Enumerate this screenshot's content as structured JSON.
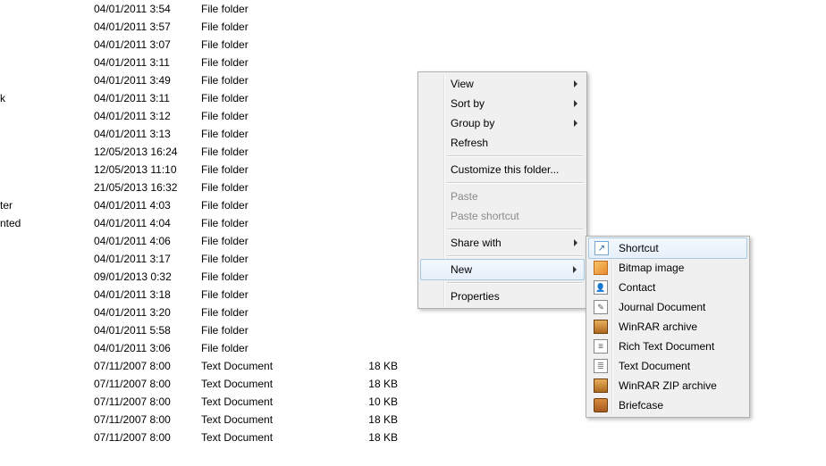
{
  "list": {
    "rows": [
      {
        "name": "",
        "date": "04/01/2011 3:54",
        "type": "File folder",
        "size": ""
      },
      {
        "name": "",
        "date": "04/01/2011 3:57",
        "type": "File folder",
        "size": ""
      },
      {
        "name": "",
        "date": "04/01/2011 3:07",
        "type": "File folder",
        "size": ""
      },
      {
        "name": "",
        "date": "04/01/2011 3:11",
        "type": "File folder",
        "size": ""
      },
      {
        "name": "",
        "date": "04/01/2011 3:49",
        "type": "File folder",
        "size": ""
      },
      {
        "name": "k",
        "date": "04/01/2011 3:11",
        "type": "File folder",
        "size": ""
      },
      {
        "name": "",
        "date": "04/01/2011 3:12",
        "type": "File folder",
        "size": ""
      },
      {
        "name": "",
        "date": "04/01/2011 3:13",
        "type": "File folder",
        "size": ""
      },
      {
        "name": "",
        "date": "12/05/2013 16:24",
        "type": "File folder",
        "size": ""
      },
      {
        "name": "",
        "date": "12/05/2013 11:10",
        "type": "File folder",
        "size": ""
      },
      {
        "name": "",
        "date": "21/05/2013 16:32",
        "type": "File folder",
        "size": ""
      },
      {
        "name": "ter",
        "date": "04/01/2011 4:03",
        "type": "File folder",
        "size": ""
      },
      {
        "name": "nted",
        "date": "04/01/2011 4:04",
        "type": "File folder",
        "size": ""
      },
      {
        "name": "",
        "date": "04/01/2011 4:06",
        "type": "File folder",
        "size": ""
      },
      {
        "name": "",
        "date": "04/01/2011 3:17",
        "type": "File folder",
        "size": ""
      },
      {
        "name": "",
        "date": "09/01/2013 0:32",
        "type": "File folder",
        "size": ""
      },
      {
        "name": "",
        "date": "04/01/2011 3:18",
        "type": "File folder",
        "size": ""
      },
      {
        "name": "",
        "date": "04/01/2011 3:20",
        "type": "File folder",
        "size": ""
      },
      {
        "name": "",
        "date": "04/01/2011 5:58",
        "type": "File folder",
        "size": ""
      },
      {
        "name": "",
        "date": "04/01/2011 3:06",
        "type": "File folder",
        "size": ""
      },
      {
        "name": "",
        "date": "07/11/2007 8:00",
        "type": "Text Document",
        "size": "18 KB"
      },
      {
        "name": "",
        "date": "07/11/2007 8:00",
        "type": "Text Document",
        "size": "18 KB"
      },
      {
        "name": "",
        "date": "07/11/2007 8:00",
        "type": "Text Document",
        "size": "10 KB"
      },
      {
        "name": "",
        "date": "07/11/2007 8:00",
        "type": "Text Document",
        "size": "18 KB"
      },
      {
        "name": "",
        "date": "07/11/2007 8:00",
        "type": "Text Document",
        "size": "18 KB"
      }
    ]
  },
  "menu_main": {
    "view": "View",
    "sort_by": "Sort by",
    "group_by": "Group by",
    "refresh": "Refresh",
    "customize": "Customize this folder...",
    "paste": "Paste",
    "paste_shortcut": "Paste shortcut",
    "share_with": "Share with",
    "new": "New",
    "properties": "Properties"
  },
  "menu_new": {
    "shortcut": "Shortcut",
    "bitmap": "Bitmap image",
    "contact": "Contact",
    "journal": "Journal Document",
    "winrar": "WinRAR archive",
    "richtext": "Rich Text Document",
    "text": "Text Document",
    "winrar_zip": "WinRAR ZIP archive",
    "briefcase": "Briefcase"
  }
}
